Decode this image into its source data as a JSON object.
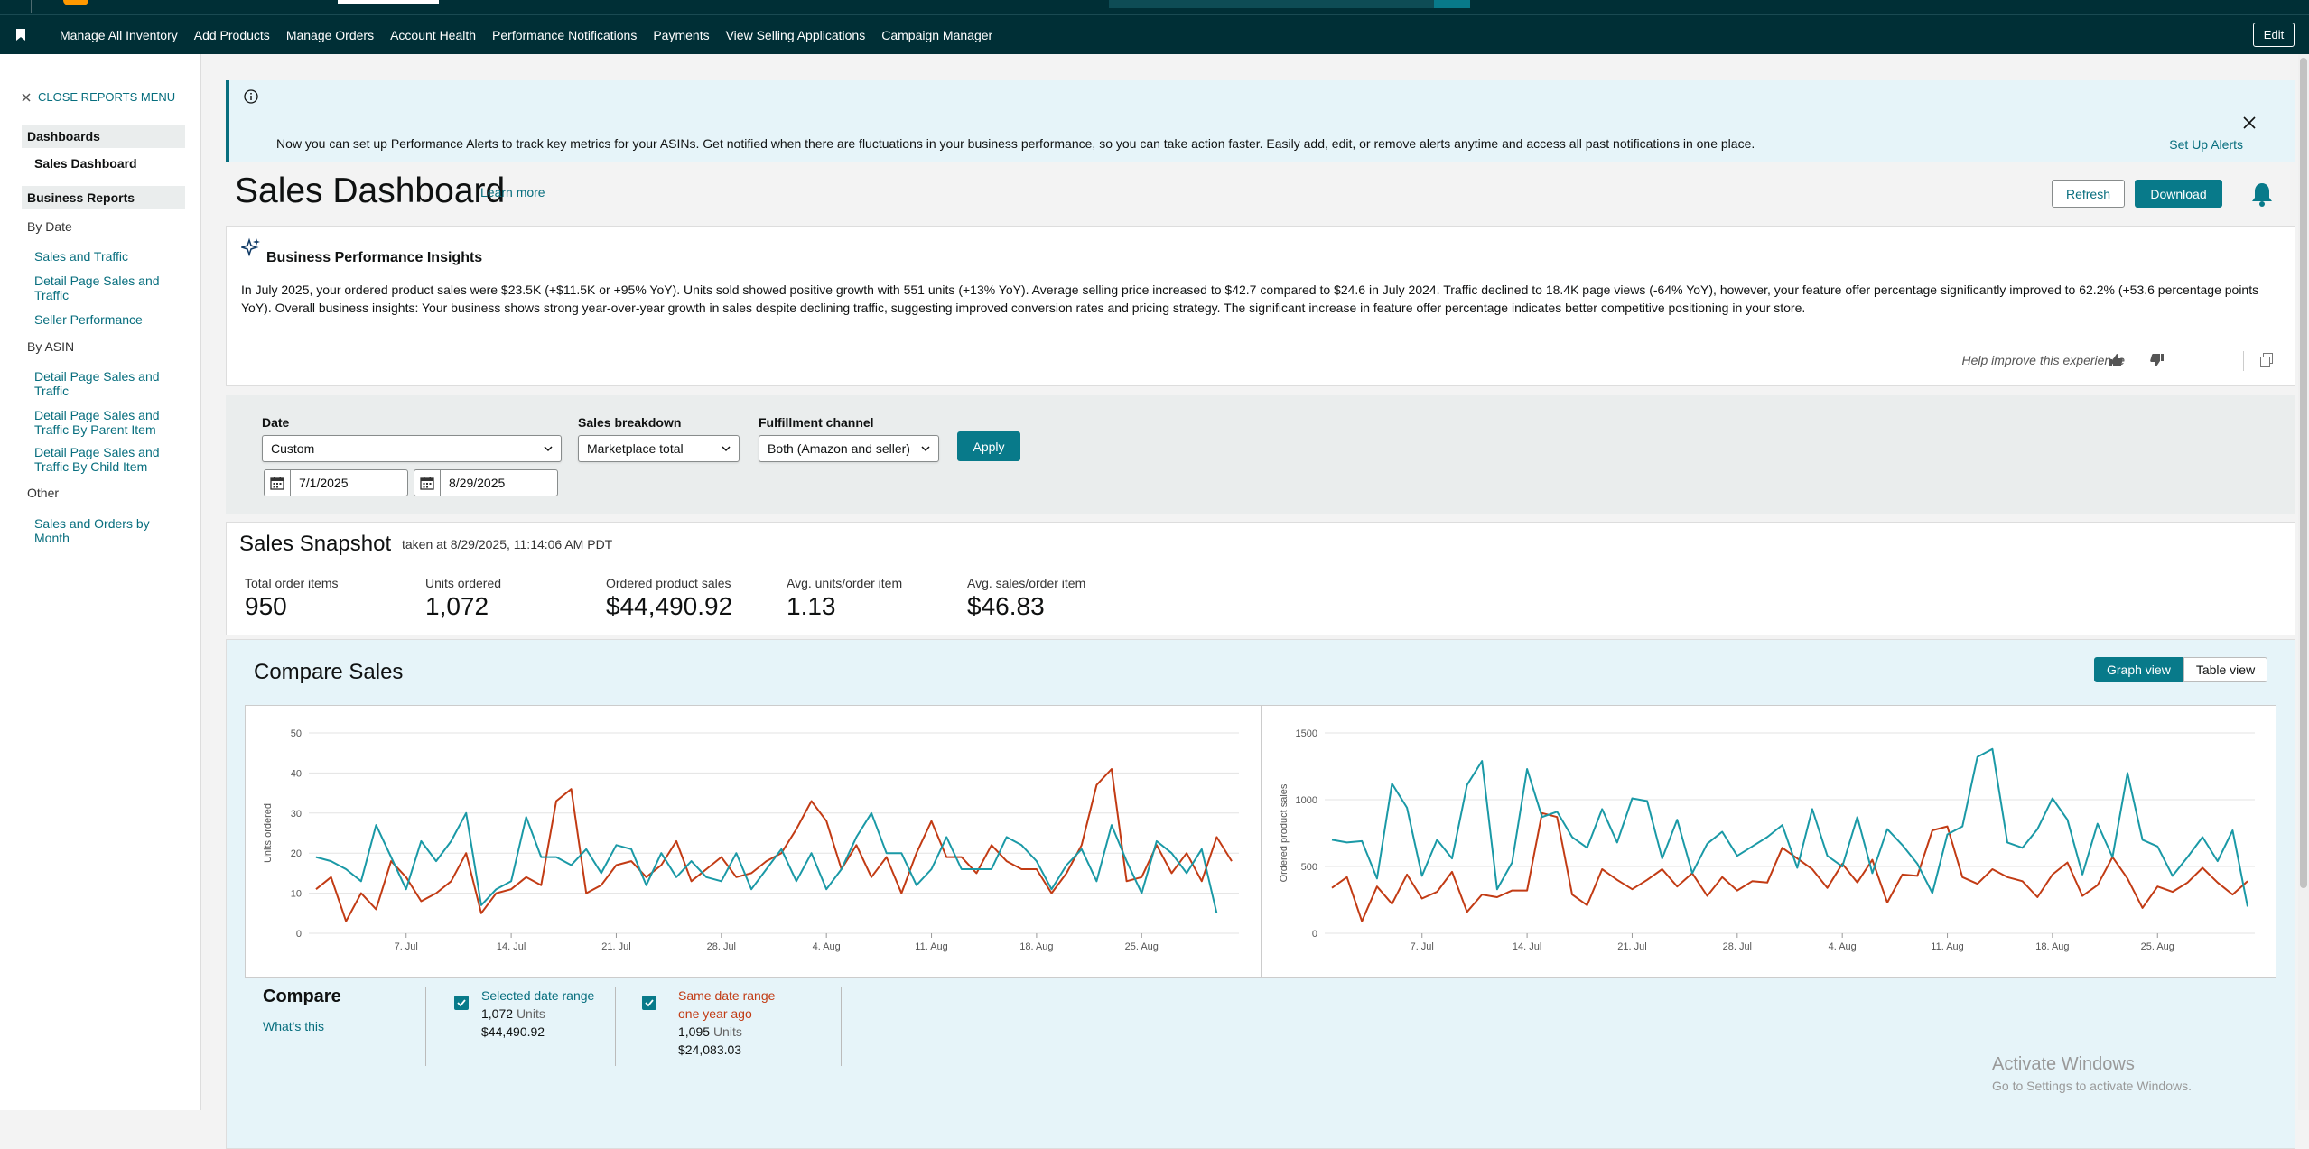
{
  "nav": {
    "items": [
      "Manage All Inventory",
      "Add Products",
      "Manage Orders",
      "Account Health",
      "Performance Notifications",
      "Payments",
      "View Selling Applications",
      "Campaign Manager"
    ],
    "edit": "Edit"
  },
  "sidebar": {
    "close": "CLOSE REPORTS MENU",
    "dashboards": "Dashboards",
    "sales_dashboard": "Sales Dashboard",
    "business_reports": "Business Reports",
    "by_date": "By Date",
    "by_date_links": [
      "Sales and Traffic",
      "Detail Page Sales and Traffic",
      "Seller Performance"
    ],
    "by_asin": "By ASIN",
    "by_asin_links": [
      "Detail Page Sales and Traffic",
      "Detail Page Sales and Traffic By Parent Item",
      "Detail Page Sales and Traffic By Child Item"
    ],
    "other": "Other",
    "other_links": [
      "Sales and Orders by Month"
    ]
  },
  "banner": {
    "text": "Now you can set up Performance Alerts to track key metrics for your ASINs. Get notified when there are fluctuations in your business performance, so you can take action faster. Easily add, edit, or remove alerts anytime and access all past notifications in one place.",
    "cta": "Set Up Alerts"
  },
  "header": {
    "title": "Sales Dashboard",
    "learn_more": "Learn more",
    "refresh": "Refresh",
    "download": "Download"
  },
  "insights": {
    "title": "Business Performance Insights",
    "body": "In July 2025, your ordered product sales were $23.5K (+$11.5K or +95% YoY). Units sold showed positive growth with 551 units (+13% YoY). Average selling price increased to $42.7 compared to $24.6 in July 2024. Traffic declined to 18.4K page views (-64% YoY), however, your feature offer percentage significantly improved to 62.2% (+53.6 percentage points YoY). Overall business insights: Your business shows strong year-over-year growth in sales despite declining traffic, suggesting improved conversion rates and pricing strategy. The significant increase in feature offer percentage indicates better competitive positioning in your store.",
    "help": "Help improve this experience"
  },
  "filters": {
    "date_label": "Date",
    "date_value": "Custom",
    "start": "7/1/2025",
    "end": "8/29/2025",
    "breakdown_label": "Sales breakdown",
    "breakdown_value": "Marketplace total",
    "fulfillment_label": "Fulfillment channel",
    "fulfillment_value": "Both (Amazon and seller)",
    "apply": "Apply"
  },
  "snapshot": {
    "title": "Sales Snapshot",
    "taken": "taken at 8/29/2025, 11:14:06 AM PDT",
    "metrics": [
      {
        "label": "Total order items",
        "value": "950"
      },
      {
        "label": "Units ordered",
        "value": "1,072"
      },
      {
        "label": "Ordered product sales",
        "value": "$44,490.92"
      },
      {
        "label": "Avg. units/order item",
        "value": "1.13"
      },
      {
        "label": "Avg. sales/order item",
        "value": "$46.83"
      }
    ]
  },
  "compare": {
    "title": "Compare Sales",
    "graph_view": "Graph view",
    "table_view": "Table view",
    "legend_title": "Compare",
    "whats_this": "What's this",
    "selected": {
      "label": "Selected date range",
      "units": "1,072",
      "units_word": "Units",
      "sales": "$44,490.92",
      "color": "#1a99a6"
    },
    "previous": {
      "label": "Same date range one year ago",
      "units": "1,095",
      "units_word": "Units",
      "sales": "$24,083.03",
      "color": "#c23b14"
    }
  },
  "watermark": {
    "line1": "Activate Windows",
    "line2": "Go to Settings to activate Windows."
  },
  "chart_data": [
    {
      "type": "line",
      "ylabel": "Units ordered",
      "ylim": [
        0,
        50
      ],
      "yticks": [
        0,
        10,
        20,
        30,
        40,
        50
      ],
      "xticks": [
        "7. Jul",
        "14. Jul",
        "21. Jul",
        "28. Jul",
        "4. Aug",
        "11. Aug",
        "18. Aug",
        "25. Aug"
      ],
      "x_start_day": 1,
      "grid": true,
      "series": [
        {
          "name": "Selected date range",
          "color": "#1a99a6",
          "values": [
            19,
            18,
            16,
            13,
            27,
            19,
            11,
            23,
            18,
            23,
            30,
            7,
            11,
            13,
            29,
            19,
            19,
            17,
            21,
            15,
            22,
            21,
            12,
            20,
            14,
            18,
            14,
            13,
            20,
            11,
            16,
            21,
            13,
            20,
            11,
            16,
            24,
            30,
            20,
            20,
            12,
            16,
            24,
            16,
            16,
            16,
            24,
            22,
            18,
            11,
            17,
            21,
            13,
            27,
            18,
            10,
            23,
            20,
            15,
            21,
            5
          ]
        },
        {
          "name": "Same date range one year ago",
          "color": "#c23b14",
          "values": [
            11,
            14,
            3,
            10,
            6,
            18,
            14,
            8,
            10,
            13,
            20,
            5,
            10,
            11,
            14,
            12,
            33,
            36,
            10,
            12,
            17,
            18,
            14,
            17,
            23,
            13,
            16,
            19,
            14,
            15,
            18,
            20,
            26,
            33,
            28,
            16,
            22,
            14,
            19,
            10,
            20,
            28,
            19,
            19,
            15,
            22,
            18,
            16,
            16,
            10,
            15,
            22,
            37,
            41,
            13,
            14,
            22,
            15,
            20,
            13,
            24,
            18
          ]
        }
      ]
    },
    {
      "type": "line",
      "ylabel": "Ordered product sales",
      "ylim": [
        0,
        1500
      ],
      "yticks": [
        0,
        500,
        1000,
        1500
      ],
      "xticks": [
        "7. Jul",
        "14. Jul",
        "21. Jul",
        "28. Jul",
        "4. Aug",
        "11. Aug",
        "18. Aug",
        "25. Aug"
      ],
      "x_start_day": 1,
      "grid": true,
      "series": [
        {
          "name": "Selected date range",
          "color": "#1a99a6",
          "values": [
            700,
            680,
            690,
            410,
            1120,
            940,
            430,
            700,
            560,
            1110,
            1290,
            330,
            530,
            1230,
            870,
            910,
            720,
            640,
            930,
            680,
            1010,
            990,
            560,
            850,
            450,
            670,
            760,
            580,
            650,
            720,
            810,
            490,
            930,
            580,
            500,
            870,
            450,
            780,
            660,
            520,
            300,
            740,
            800,
            1320,
            1380,
            680,
            640,
            780,
            1010,
            850,
            440,
            820,
            570,
            1200,
            700,
            650,
            430,
            570,
            720,
            540,
            770,
            200
          ]
        },
        {
          "name": "Same date range one year ago",
          "color": "#c23b14",
          "values": [
            340,
            420,
            90,
            350,
            220,
            440,
            260,
            310,
            460,
            160,
            290,
            270,
            320,
            320,
            900,
            870,
            290,
            210,
            480,
            400,
            330,
            400,
            480,
            350,
            450,
            280,
            420,
            320,
            390,
            380,
            640,
            560,
            480,
            340,
            520,
            380,
            550,
            230,
            440,
            430,
            770,
            800,
            420,
            370,
            480,
            420,
            390,
            270,
            440,
            530,
            280,
            360,
            570,
            410,
            190,
            350,
            310,
            380,
            490,
            380,
            290,
            390
          ]
        }
      ]
    }
  ]
}
